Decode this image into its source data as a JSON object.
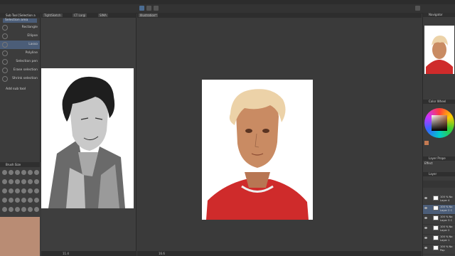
{
  "subtool": {
    "header_label": "Sub Tool [Selection a",
    "active_group": "Selection area",
    "items": [
      {
        "label": "Rectangle"
      },
      {
        "label": "Ellipse"
      },
      {
        "label": "Lasso"
      },
      {
        "label": "Polyline"
      },
      {
        "label": "Selection pen"
      },
      {
        "label": "Erase selection"
      },
      {
        "label": "Shrink selection"
      }
    ],
    "add_label": "Add sub tool"
  },
  "brush_panel": {
    "header_label": "Brush Size"
  },
  "windows": {
    "ref_tabs": [
      {
        "label": "TightSketch"
      },
      {
        "label": "CT Largi"
      },
      {
        "label": "SIMA"
      }
    ],
    "main_tab": "Illustration*"
  },
  "status": {
    "ref_zoom": "11.4",
    "main_zoom": "16.6"
  },
  "navigator": {
    "header_label": "Navigator"
  },
  "color_wheel": {
    "header_label": "Color Wheel",
    "accent": "#c47a52"
  },
  "layer_panel": {
    "header_label": "Layer Prope",
    "effect_label": "Effect",
    "layer_header": "Layer",
    "layers": [
      {
        "line1": "100 % No",
        "line2": "Layer 4",
        "selected": false
      },
      {
        "line1": "100 % No",
        "line2": "Layer 2 C",
        "selected": true
      },
      {
        "line1": "100 % No",
        "line2": "Layer 3 C",
        "selected": false
      },
      {
        "line1": "100 % No",
        "line2": "Layer 2",
        "selected": false
      },
      {
        "line1": "100 % No",
        "line2": "Layer 1",
        "selected": false
      },
      {
        "line1": "100 % No",
        "line2": "Pap",
        "selected": false
      }
    ]
  }
}
